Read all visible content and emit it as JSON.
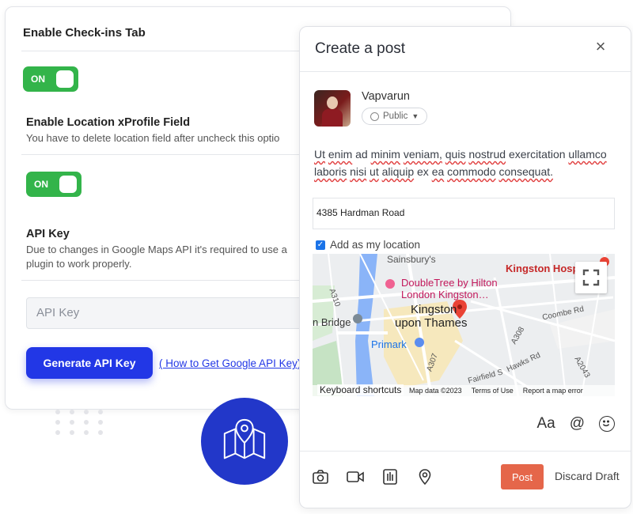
{
  "settings": {
    "checkins_title": "Enable Check-ins Tab",
    "toggle_on": "ON",
    "location_heading": "Enable Location xProfile Field",
    "location_desc": "You have to delete location field after uncheck this optio",
    "api_heading": "API Key",
    "api_desc_line1": "Due to changes in Google Maps API it's required to use a",
    "api_desc_line2": "plugin to work properly.",
    "api_placeholder": "API Key",
    "generate_label": "Generate API Key",
    "help_link": "( How to Get Google API Key)"
  },
  "post": {
    "title": "Create a post",
    "close_glyph": "×",
    "username": "Vapvarun",
    "privacy": "Public",
    "text_words": [
      "Ut",
      "enim",
      "ad",
      "minim",
      "veniam,",
      "quis",
      "nostrud",
      "exercitation",
      "ullamco",
      "laboris",
      "nisi",
      "ut",
      "aliquip",
      "ex",
      "ea",
      "commodo",
      "consequat."
    ],
    "location_value": "4385 Hardman Road",
    "add_location_label": "Add as my location",
    "text_format_label": "Aa",
    "mention_label": "@",
    "post_button": "Post",
    "discard_label": "Discard Draft"
  },
  "map": {
    "labels": {
      "doubletree": "DoubleTree by Hilton",
      "doubletree2": "London Kingston…",
      "kingston1": "Kingston",
      "kingston2": "upon Thames",
      "kingston_hosp": "Kingston Hosp",
      "primark": "Primark",
      "bridge": "n Bridge",
      "sainsbury": "Sainsbury's",
      "coombe": "Coombe Rd",
      "a308": "A308",
      "a310": "A310",
      "a307": "A307",
      "a2043": "A2043",
      "hawks": "Hawks Rd",
      "fairfield": "Fairfield S"
    },
    "keyboard_shortcuts": "Keyboard shortcuts",
    "map_data": "Map data ©2023",
    "terms": "Terms of Use",
    "report": "Report a map error",
    "colors": {
      "water": "#8ab4f8",
      "park": "#c6e3c4",
      "town": "#f6e8bd",
      "road": "#ffffff",
      "pin": "#ea4335"
    }
  },
  "icons": [
    "toggle-knob",
    "map-icon",
    "close-icon",
    "globe-icon",
    "chevron-down-icon",
    "fullscreen-icon",
    "text-format-icon",
    "at-icon",
    "smiley-icon",
    "camera-icon",
    "video-icon",
    "gif-icon",
    "location-icon"
  ]
}
